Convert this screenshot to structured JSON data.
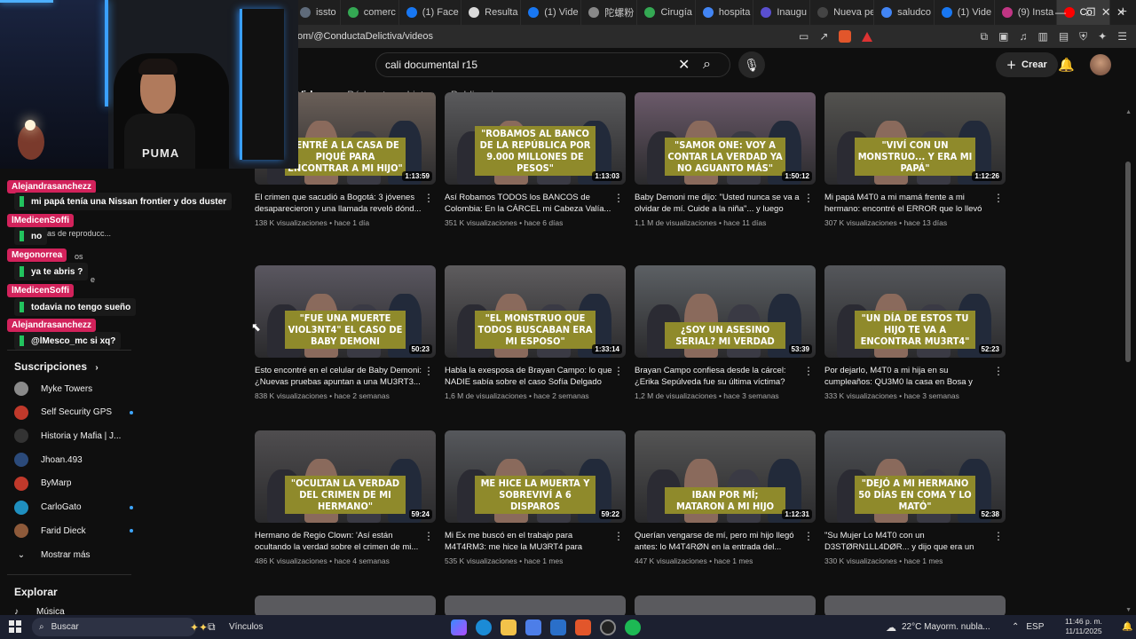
{
  "browser": {
    "tabs": [
      {
        "label": "issto",
        "color": "#5f6b7a"
      },
      {
        "label": "comerc",
        "color": "#34a853"
      },
      {
        "label": "(1) Face",
        "color": "#1877f2"
      },
      {
        "label": "Resulta",
        "color": "#d9d9d9"
      },
      {
        "label": "(1) Vide",
        "color": "#1877f2"
      },
      {
        "label": "陀螺粉",
        "color": "#888888"
      },
      {
        "label": "Cirugía",
        "color": "#34a853"
      },
      {
        "label": "hospita",
        "color": "#4285f4"
      },
      {
        "label": "Inaugu",
        "color": "#5a4fcf"
      },
      {
        "label": "Nueva pest",
        "color": "#444444"
      },
      {
        "label": "saludco",
        "color": "#4285f4"
      },
      {
        "label": "(1) Vide",
        "color": "#1877f2"
      },
      {
        "label": "(9) Insta",
        "color": "#c13584"
      },
      {
        "label": "Co",
        "color": "#ff0000",
        "active": true
      }
    ],
    "new_tab": "+",
    "url": "om/@ConductaDelictiva/videos"
  },
  "youtube": {
    "search_value": "cali documental r15",
    "create_label": "Crear",
    "channel_tabs": [
      {
        "label": "Videos",
        "active": true
      },
      {
        "label": "Pódcasts"
      },
      {
        "label": "Listas"
      },
      {
        "label": "Publicaciones"
      }
    ]
  },
  "videos": [
    {
      "banner": "\"ENTRÉ A LA CASA DE PIQUÉ PARA ENCONTRAR A MI HIJO\"",
      "duration": "1:13:59",
      "title": "El crimen que sacudió a Bogotá: 3 jóvenes desaparecieron y una llamada reveló dónd...",
      "meta": "138 K visualizaciones • hace 1 día",
      "bg": "#6a5f58"
    },
    {
      "banner": "\"ROBAMOS AL BANCO DE LA REPÚBLICA POR 9.000 MILLONES DE PESOS\"",
      "duration": "1:13:03",
      "title": "Así Robamos TODOS los BANCOS de Colombia: En la CÁRCEL mi Cabeza Valía...",
      "meta": "351 K visualizaciones • hace 6 días",
      "bg": "#5a5a5c"
    },
    {
      "banner": "\"SAMOR ONE: VOY A CONTAR LA VERDAD YA NO AGUANTO MÁS\"",
      "duration": "1:50:12",
      "title": "Baby Demoni me dijo: \"Usted nunca se va a olvidar de mí. Cuide a la niña\"... y luego pas...",
      "meta": "1,1 M de visualizaciones • hace 11 días",
      "bg": "#6b5a6a"
    },
    {
      "banner": "\"VIVÍ CON UN MONSTRUO... Y ERA MI PAPÁ\"",
      "duration": "1:12:26",
      "title": "Mi papá M4T0 a mi mamá frente a mi hermano: encontré el ERROR que lo llevó a...",
      "meta": "307 K visualizaciones • hace 13 días",
      "bg": "#53524f"
    },
    {
      "banner": "\"FUE UNA MUERTE VIOL3NT4\" EL CASO DE BABY DEMONI",
      "duration": "50:23",
      "title": "Esto encontré en el celular de Baby Demoni: ¿Nuevas pruebas apuntan a una MU3RT3...",
      "meta": "838 K visualizaciones • hace 2 semanas",
      "bg": "#5a5760"
    },
    {
      "banner": "\"EL MONSTRUO QUE TODOS BUSCABAN ERA MI ESPOSO\"",
      "duration": "1:33:14",
      "title": "Habla la exesposa de Brayan Campo: lo que NADIE sabía sobre el caso Sofía Delgado",
      "meta": "1,6 M de visualizaciones • hace 2 semanas",
      "bg": "#5e5c5e"
    },
    {
      "banner": "¿SOY UN ASESINO SERIAL? MI VERDAD",
      "duration": "53:39",
      "title": "Brayan Campo confiesa desde la cárcel: ¿Erika Sepúlveda fue su última víctima?",
      "meta": "1,2 M de visualizaciones • hace 3 semanas",
      "bg": "#5c6064"
    },
    {
      "banner": "\"UN DÍA DE ESTOS TU HIJO TE VA A ENCONTRAR MU3RT4\"",
      "duration": "52:23",
      "title": "Por dejarlo, M4T0 a mi hija en su cumpleaños: QU3M0 la casa en Bosa y hoy...",
      "meta": "333 K visualizaciones • hace 3 semanas",
      "bg": "#55575b"
    },
    {
      "banner": "\"OCULTAN LA VERDAD DEL CRIMEN DE MI HERMANO\"",
      "duration": "59:24",
      "title": "Hermano de Regio Clown: 'Así están ocultando la verdad sobre el crimen de mi...",
      "meta": "486 K visualizaciones • hace 4 semanas",
      "bg": "#4f4d4f"
    },
    {
      "banner": "ME HICE LA MUERTA Y SOBREVIVÍ A 6 DISPAROS",
      "duration": "59:22",
      "title": "Mi Ex me buscó en el trabajo para M4T4RM3: me hice la MU3RT4 para salvar...",
      "meta": "535 K visualizaciones • hace 1 mes",
      "bg": "#56585c"
    },
    {
      "banner": "IBAN POR MÍ; MATARON A MI HIJO",
      "duration": "1:12:31",
      "title": "Querían vengarse de mí, pero mi hijo llegó antes: lo M4T4RØN en la entrada del...",
      "meta": "447 K visualizaciones • hace 1 mes",
      "bg": "#545454"
    },
    {
      "banner": "\"DEJÓ A MI HERMANO 50 DÍAS EN COMA Y LO MATÓ\"",
      "duration": "52:38",
      "title": "\"Su Mujer Lo M4T0 con un D3STØRN1LL4DØR... y dijo que era un jueg...",
      "meta": "330 K visualizaciones • hace 1 mes",
      "bg": "#4e5054"
    }
  ],
  "sidebar": {
    "partial_labels": [
      "stas de reproducc...",
      "os",
      "e"
    ],
    "subscriptions_label": "Suscripciones",
    "subscriptions": [
      {
        "name": "Myke Towers",
        "color": "#8a8a8a",
        "live": false
      },
      {
        "name": "Self Security GPS",
        "color": "#c0392b",
        "live": true
      },
      {
        "name": "Historia y Mafia | J...",
        "color": "#333333",
        "live": false
      },
      {
        "name": "Jhoan.493",
        "color": "#2b4a7a",
        "live": false
      },
      {
        "name": "ByMarp",
        "color": "#c0392b",
        "live": false
      },
      {
        "name": "CarloGato",
        "color": "#1f8fbf",
        "live": true
      },
      {
        "name": "Farid Dieck",
        "color": "#8e5a3a",
        "live": true
      }
    ],
    "show_more": "Mostrar más",
    "explore": "Explorar",
    "music": "Música"
  },
  "chat": [
    {
      "user": "Alejandrasanchezz",
      "msg": "mi papá tenía una Nissan frontier y dos duster"
    },
    {
      "user": "lMedicenSoffi",
      "msg": "no"
    },
    {
      "user": "Megonorrea",
      "msg": "ya te abris ?"
    },
    {
      "user": "lMedicenSoffi",
      "msg": "todavia no tengo sueño"
    },
    {
      "user": "Alejandrasanchezz",
      "msg": "@lMesco_mc si xq?"
    }
  ],
  "webcam": {
    "shirt_text": "PUMA"
  },
  "taskbar": {
    "search_label": "Buscar",
    "vinculos": "Vínculos",
    "weather": "22°C  Mayorm. nubla...",
    "lang": "ESP",
    "time": "11:46 p. m.",
    "date": "11/11/2025"
  }
}
